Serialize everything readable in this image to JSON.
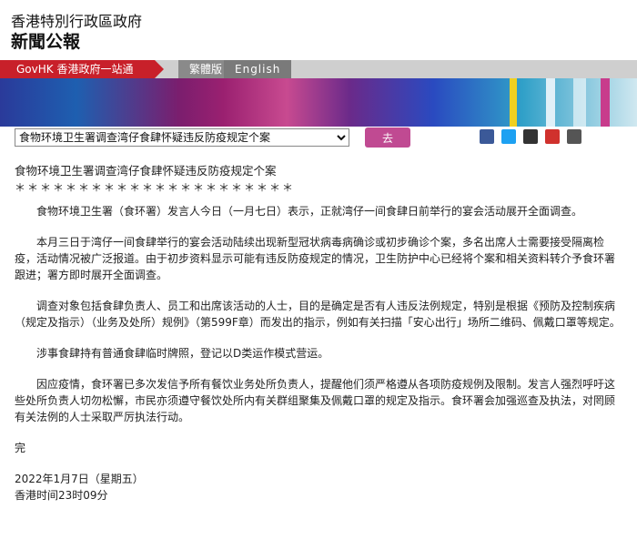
{
  "header": {
    "gov_name": "香港特別行政區政府",
    "gov_title": "新聞公報"
  },
  "nav": {
    "govhk": "GovHK 香港政府一站通",
    "traditional": "繁體版",
    "english": "English"
  },
  "toolbar": {
    "select_value": "食物环境卫生署调查湾仔食肆怀疑违反防疫规定个案",
    "go_label": "去",
    "share_icons": [
      "facebook-icon",
      "twitter-icon",
      "email-icon",
      "weibo-icon",
      "print-icon"
    ]
  },
  "article": {
    "title": "食物环境卫生署调查湾仔食肆怀疑违反防疫规定个案",
    "stars": "＊＊＊＊＊＊＊＊＊＊＊＊＊＊＊＊＊＊＊＊＊＊",
    "paragraphs": [
      "食物环境卫生署（食环署）发言人今日（一月七日）表示，正就湾仔一间食肆日前举行的宴会活动展开全面调查。",
      "本月三日于湾仔一间食肆举行的宴会活动陆续出现新型冠状病毒病确诊或初步确诊个案，多名出席人士需要接受隔离检疫，活动情况被广泛报道。由于初步资料显示可能有违反防疫规定的情况，卫生防护中心已经将个案和相关资料转介予食环署跟进；署方即时展开全面调查。",
      "调查对象包括食肆负责人、员工和出席该活动的人士，目的是确定是否有人违反法例规定，特别是根据《预防及控制疾病（规定及指示）（业务及处所）规例》（第599F章）而发出的指示，例如有关扫描「安心出行」场所二维码、佩戴口罩等规定。",
      "涉事食肆持有普通食肆临时牌照，登记以D类运作模式营运。",
      "因应疫情，食环署已多次发信予所有餐饮业务处所负责人，提醒他们须严格遵从各项防疫规例及限制。发言人强烈呼吁这些处所负责人切勿松懈，市民亦须遵守餐饮处所内有关群组聚集及佩戴口罩的规定及指示。食环署会加强巡查及执法，对罔顾有关法例的人士采取严厉执法行动。"
    ],
    "end": "完",
    "date": "2022年1月7日（星期五）",
    "time": "香港时间23时09分"
  },
  "colors": {
    "accent_red": "#c8202a",
    "go_button": "#c04a92"
  }
}
